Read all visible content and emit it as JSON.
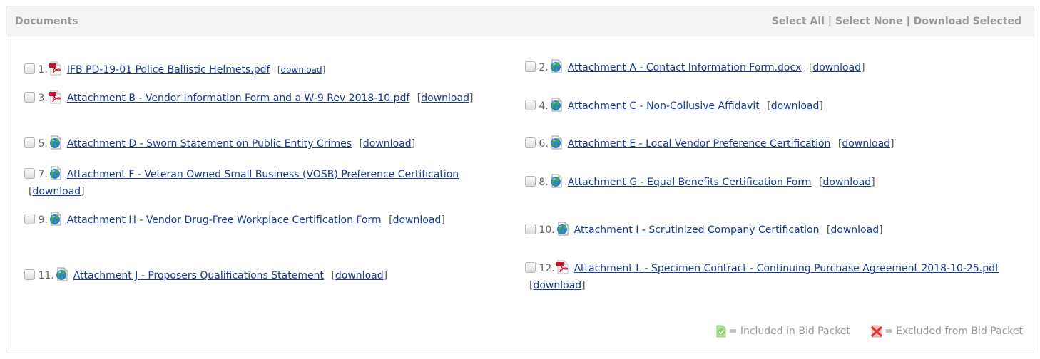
{
  "panel": {
    "title": "Documents",
    "actions": {
      "select_all": "Select All",
      "select_none": "Select None",
      "download_selected": "Download Selected",
      "separator": "|"
    }
  },
  "documents": [
    {
      "number": "1.",
      "icon": "pdf-icon",
      "name": "IFB PD-19-01 Police Ballistic Helmets.pdf",
      "download": "download",
      "checked": false
    },
    {
      "number": "2.",
      "icon": "globe-document-icon",
      "name": "Attachment A - Contact Information Form.docx",
      "download": "download",
      "checked": false
    },
    {
      "number": "3.",
      "icon": "pdf-icon",
      "name": "Attachment B - Vendor Information Form and a W-9 Rev 2018-10.pdf",
      "download": "download",
      "checked": false
    },
    {
      "number": "4.",
      "icon": "globe-document-icon",
      "name": "Attachment C - Non-Collusive Affidavit",
      "download": "download",
      "checked": false
    },
    {
      "number": "5.",
      "icon": "globe-document-icon",
      "name": "Attachment D - Sworn Statement on Public Entity Crimes",
      "download": "download",
      "checked": false
    },
    {
      "number": "6.",
      "icon": "globe-document-icon",
      "name": "Attachment E - Local Vendor Preference Certification",
      "download": "download",
      "checked": false
    },
    {
      "number": "7.",
      "icon": "globe-document-icon",
      "name": "Attachment F - Veteran Owned Small Business (VOSB) Preference Certification",
      "download": "download",
      "checked": false
    },
    {
      "number": "8.",
      "icon": "globe-document-icon",
      "name": "Attachment G - Equal Benefits Certification Form",
      "download": "download",
      "checked": false
    },
    {
      "number": "9.",
      "icon": "globe-document-icon",
      "name": "Attachment H - Vendor Drug-Free Workplace Certification Form",
      "download": "download",
      "checked": false
    },
    {
      "number": "10.",
      "icon": "globe-document-icon",
      "name": "Attachment I - Scrutinized Company Certification",
      "download": "download",
      "checked": false
    },
    {
      "number": "11.",
      "icon": "globe-document-icon",
      "name": "Attachment J - Proposers Qualifications Statement",
      "download": "download",
      "checked": false
    },
    {
      "number": "12.",
      "icon": "pdf-icon",
      "name": "Attachment L - Specimen Contract - Continuing Purchase Agreement 2018-10-25.pdf",
      "download": "download",
      "checked": false
    }
  ],
  "legend": {
    "included_icon": "included-in-packet-icon",
    "included_text": "= Included in Bid Packet",
    "excluded_icon": "excluded-from-packet-icon",
    "excluded_text": "= Excluded from Bid Packet"
  },
  "colors": {
    "link": "#1a3b8e",
    "header_bg": "#f4f4f4",
    "header_text": "#999999",
    "pdf_red": "#c8102e"
  }
}
